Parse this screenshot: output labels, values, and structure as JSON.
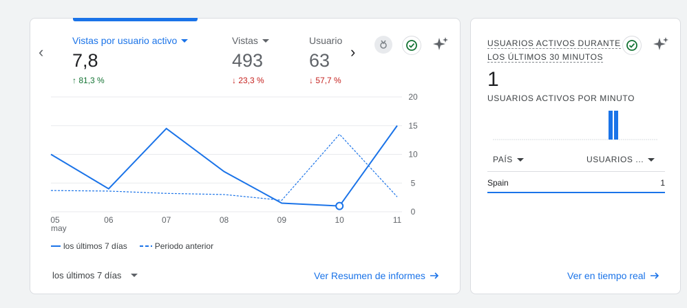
{
  "main_card": {
    "metrics": [
      {
        "label": "Vistas por usuario activo",
        "value": "7,8",
        "delta": "81,3 %",
        "direction": "up"
      },
      {
        "label": "Vistas",
        "value": "493",
        "delta": "23,3 %",
        "direction": "down"
      },
      {
        "label": "Usuario",
        "value": "63",
        "delta": "57,7 %",
        "direction": "down"
      }
    ],
    "legend": {
      "current": "los últimos 7 días",
      "previous": "Periodo anterior"
    },
    "date_range": "los últimos 7 días",
    "link": "Ver Resumen de informes"
  },
  "chart_data": {
    "type": "line",
    "x": [
      "05",
      "06",
      "07",
      "08",
      "09",
      "10",
      "11"
    ],
    "x_sublabel": "may",
    "ylim": [
      0,
      20
    ],
    "yticks": [
      "20",
      "15",
      "10",
      "5",
      "0"
    ],
    "series": [
      {
        "name": "los últimos 7 días",
        "values": [
          10,
          4,
          14.5,
          7,
          1.5,
          1,
          15
        ]
      },
      {
        "name": "Periodo anterior",
        "values": [
          3.7,
          3.6,
          3.2,
          3,
          2,
          13.5,
          2.6
        ]
      }
    ],
    "colors": {
      "current": "#1a73e8",
      "previous": "#1a73e8"
    }
  },
  "realtime_card": {
    "title_line1": "USUARIOS ACTIVOS DURANTE",
    "title_line2": "LOS ÚLTIMOS 30 MINUTOS",
    "value": "1",
    "subtitle": "USUARIOS ACTIVOS POR MINUTO",
    "col_country": "PAÍS",
    "col_users": "USUARIOS ...",
    "rows": [
      {
        "country": "Spain",
        "users": "1"
      }
    ],
    "link": "Ver en tiempo real"
  }
}
